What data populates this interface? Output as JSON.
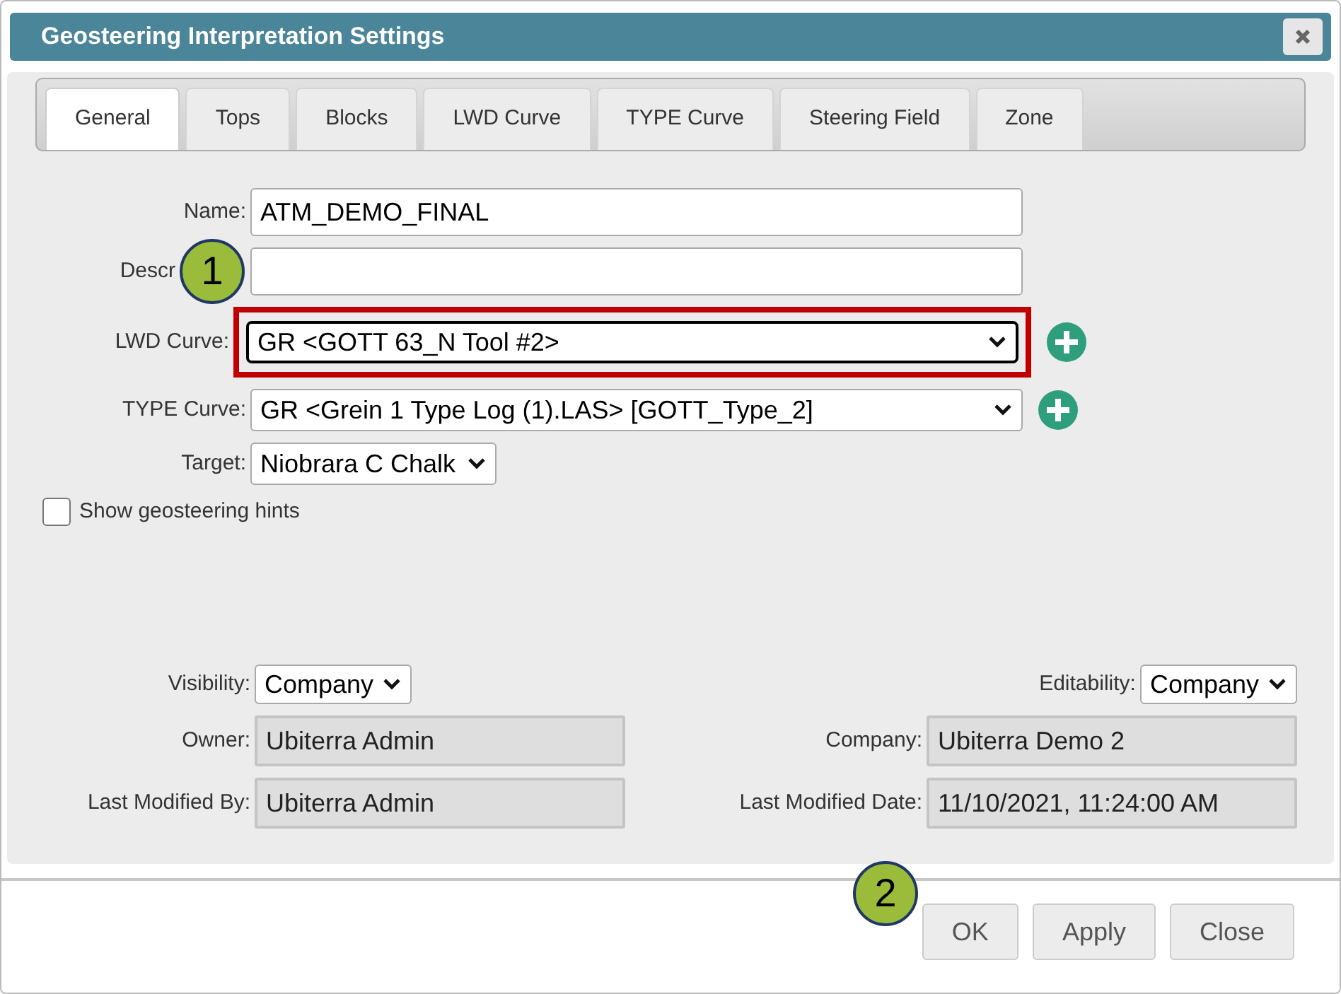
{
  "window": {
    "title": "Geosteering Interpretation Settings"
  },
  "tabs": [
    {
      "label": "General",
      "selected": true
    },
    {
      "label": "Tops",
      "selected": false
    },
    {
      "label": "Blocks",
      "selected": false
    },
    {
      "label": "LWD Curve",
      "selected": false
    },
    {
      "label": "TYPE Curve",
      "selected": false
    },
    {
      "label": "Steering Field",
      "selected": false
    },
    {
      "label": "Zone",
      "selected": false
    }
  ],
  "form": [
    {
      "kind": "text",
      "label": "Name:",
      "value": "ATM_DEMO_FINAL",
      "highlighted": false
    },
    {
      "kind": "text",
      "label": "Descr",
      "highlighted": false,
      "callout": "1"
    },
    {
      "kind": "select",
      "label": "LWD Curve:",
      "value": "GR <GOTT 63_N Tool #2>",
      "highlighted": true,
      "add": true
    },
    {
      "kind": "select",
      "label": "TYPE Curve:",
      "value": "GR <Grein 1 Type Log (1).LAS> [GOTT_Type_2]",
      "highlighted": false,
      "add": true
    },
    {
      "kind": "dropdown",
      "label": "Target:",
      "value": "Niobrara C Chalk",
      "highlighted": false
    }
  ],
  "hints_checkbox": {
    "label": "Show geosteering hints",
    "checked": false
  },
  "meta_left": [
    {
      "kind": "dropdown",
      "label": "Visibility:",
      "value": "Company"
    },
    {
      "kind": "readonly",
      "label": "Owner:",
      "value": "Ubiterra Admin"
    },
    {
      "kind": "readonly",
      "label": "Last Modified By:",
      "value": "Ubiterra Admin"
    }
  ],
  "meta_right": [
    {
      "kind": "dropdown",
      "label": "Editability:",
      "value": "Company"
    },
    {
      "kind": "readonly",
      "label": "Company:",
      "value": "Ubiterra Demo 2"
    },
    {
      "kind": "readonly",
      "label": "Last Modified Date:",
      "value": "11/10/2021, 11:24:00 AM"
    }
  ],
  "footer_callout": "2",
  "buttons": [
    "OK",
    "Apply",
    "Close"
  ]
}
